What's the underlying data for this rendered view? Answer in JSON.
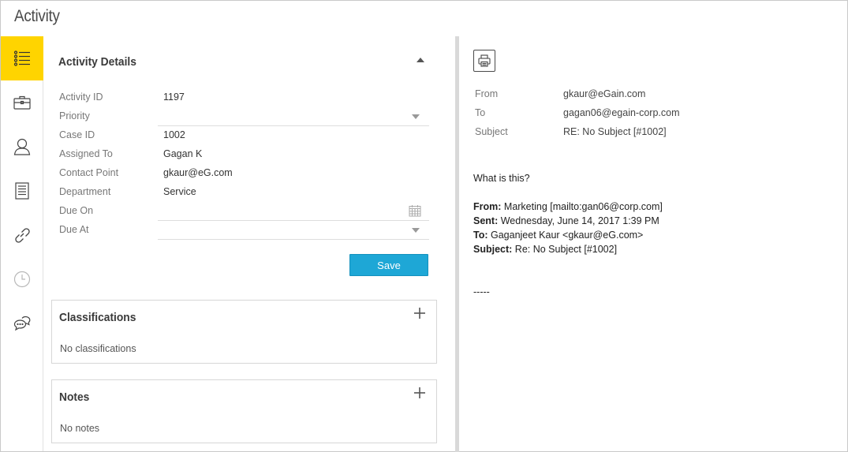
{
  "app": {
    "title": "Activity"
  },
  "rail": {
    "items": [
      {
        "name": "activity-details",
        "icon": "list-icon",
        "active": true
      },
      {
        "name": "case",
        "icon": "briefcase-icon"
      },
      {
        "name": "customer",
        "icon": "user-icon"
      },
      {
        "name": "knowledge",
        "icon": "document-icon"
      },
      {
        "name": "links",
        "icon": "link-icon"
      },
      {
        "name": "history",
        "icon": "clock-icon"
      },
      {
        "name": "chat",
        "icon": "chat-bubbles-icon"
      }
    ]
  },
  "details": {
    "title": "Activity Details",
    "fields": {
      "activity_id": {
        "label": "Activity ID",
        "value": "1197"
      },
      "priority": {
        "label": "Priority",
        "value": ""
      },
      "case_id": {
        "label": "Case ID",
        "value": "1002"
      },
      "assigned_to": {
        "label": "Assigned To",
        "value": "Gagan K"
      },
      "contact_point": {
        "label": "Contact Point",
        "value": "gkaur@eG.com"
      },
      "department": {
        "label": "Department",
        "value": "Service"
      },
      "due_on": {
        "label": "Due On",
        "value": ""
      },
      "due_at": {
        "label": "Due At",
        "value": ""
      }
    },
    "save_label": "Save"
  },
  "classifications": {
    "title": "Classifications",
    "empty_text": "No classifications"
  },
  "notes": {
    "title": "Notes",
    "empty_text": "No notes"
  },
  "email": {
    "headers": {
      "from": {
        "label": "From",
        "value": "gkaur@eGain.com"
      },
      "to": {
        "label": "To",
        "value": "gagan06@egain-corp.com"
      },
      "subject": {
        "label": "Subject",
        "value": "RE: No Subject [#1002]"
      }
    },
    "body": {
      "greeting": "What is this?",
      "quoted": {
        "from_label": "From:",
        "from_value": "Marketing [mailto:gan06@corp.com]",
        "sent_label": "Sent:",
        "sent_value": "Wednesday, June 14, 2017 1:39 PM",
        "to_label": "To:",
        "to_value": "Gaganjeet Kaur <gkaur@eG.com>",
        "subject_label": "Subject:",
        "subject_value": "Re: No Subject [#1002]"
      },
      "separator": "-----"
    }
  },
  "colors": {
    "accent": "#ffd400",
    "primary_button": "#1ea7d6"
  }
}
